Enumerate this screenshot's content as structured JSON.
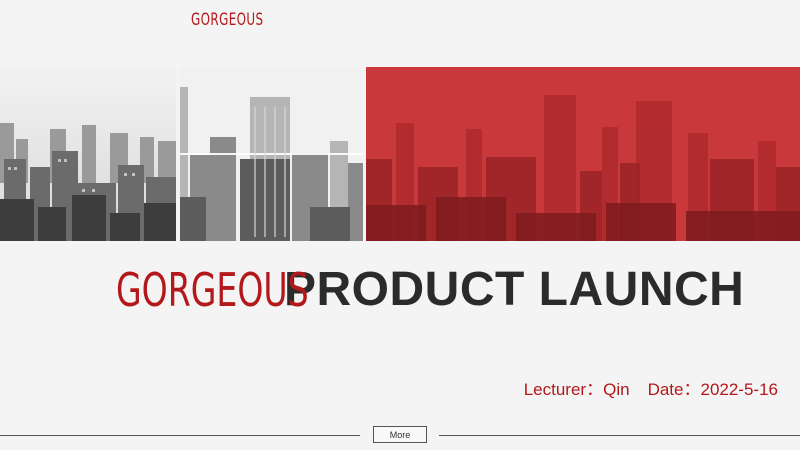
{
  "header": {
    "logo_text": "GORGEOUS"
  },
  "hero": {
    "brand_word": "GORGEOUS",
    "headline": "PRODUCT LAUNCH"
  },
  "meta": {
    "lecturer_label": "Lecturer：",
    "lecturer_name": "Qin",
    "date_label": "Date：",
    "date_value": "2022-5-16"
  },
  "footer": {
    "more_label": "More"
  },
  "colors": {
    "accent": "#b3191b",
    "text_dark": "#2b2b2b",
    "background": "#f4f4f4"
  },
  "images": [
    {
      "name": "city-skyline-photo-left"
    },
    {
      "name": "city-skyscraper-photo-middle"
    },
    {
      "name": "city-skyline-photo-red-overlay"
    }
  ]
}
